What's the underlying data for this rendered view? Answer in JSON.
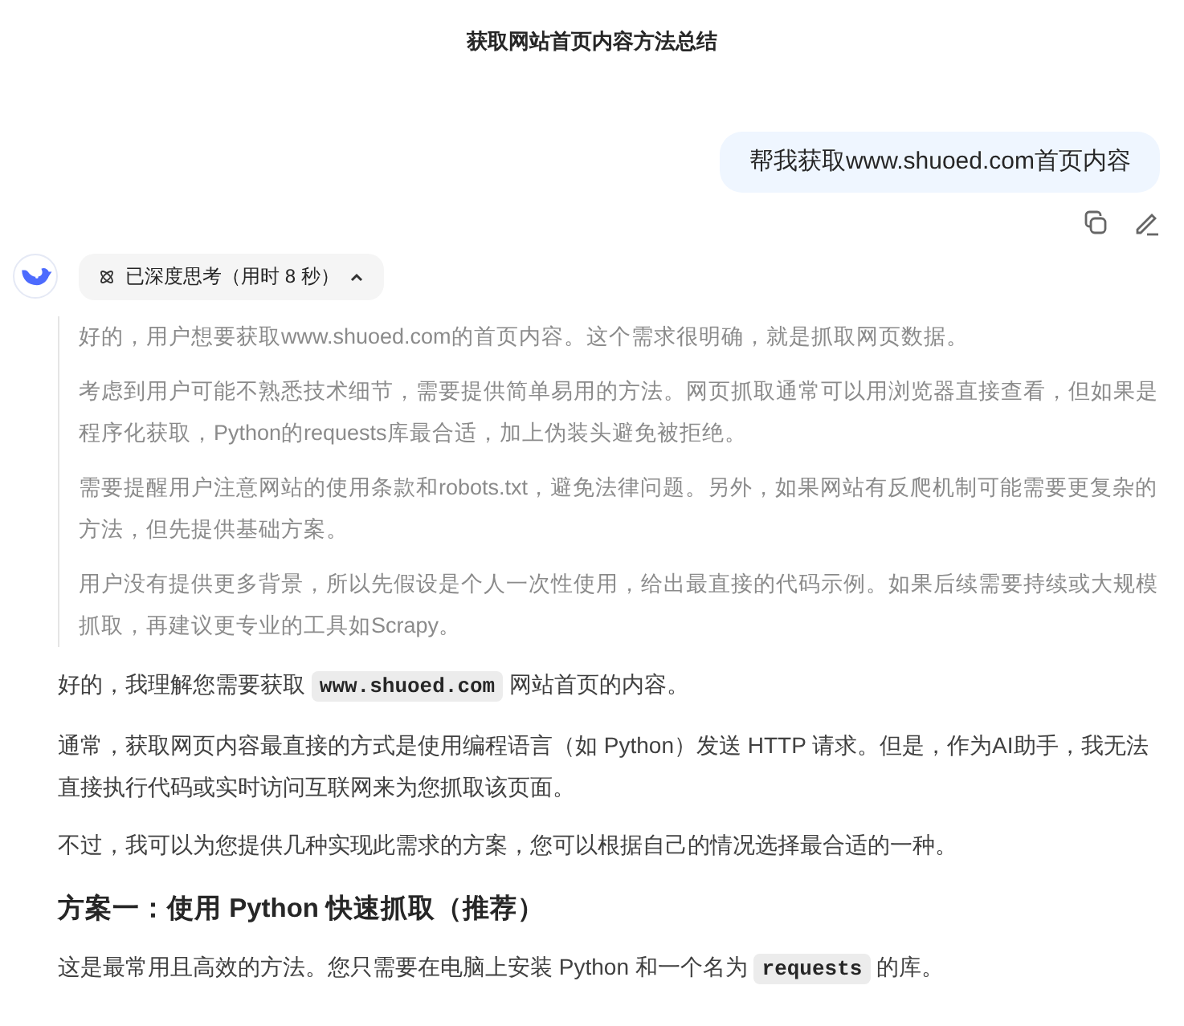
{
  "header": {
    "title": "获取网站首页内容方法总结"
  },
  "user_message": {
    "text": "帮我获取www.shuoed.com首页内容"
  },
  "message_actions": [
    {
      "kind": "copy"
    },
    {
      "kind": "edit"
    }
  ],
  "thinking": {
    "label": "已深度思考（用时 8 秒）",
    "expanded": true,
    "paragraphs": [
      "好的，用户想要获取www.shuoed.com的首页内容。这个需求很明确，就是抓取网页数据。",
      "考虑到用户可能不熟悉技术细节，需要提供简单易用的方法。网页抓取通常可以用浏览器直接查看，但如果是程序化获取，Python的requests库最合适，加上伪装头避免被拒绝。",
      "需要提醒用户注意网站的使用条款和robots.txt，避免法律问题。另外，如果网站有反爬机制可能需要更复杂的方法，但先提供基础方案。",
      "用户没有提供更多背景，所以先假设是个人一次性使用，给出最直接的代码示例。如果后续需要持续或大规模抓取，再建议更专业的工具如Scrapy。"
    ]
  },
  "answer": [
    {
      "kind": "paragraph",
      "parts": [
        {
          "kind": "text",
          "text": "好的，我理解您需要获取 "
        },
        {
          "kind": "code",
          "text": "www.shuoed.com"
        },
        {
          "kind": "text",
          "text": " 网站首页的内容。"
        }
      ]
    },
    {
      "kind": "paragraph",
      "parts": [
        {
          "kind": "text",
          "text": "通常，获取网页内容最直接的方式是使用编程语言（如 Python）发送 HTTP 请求。但是，作为AI助手，我无法直接执行代码或实时访问互联网来为您抓取该页面。"
        }
      ]
    },
    {
      "kind": "paragraph",
      "parts": [
        {
          "kind": "text",
          "text": "不过，我可以为您提供几种实现此需求的方案，您可以根据自己的情况选择最合适的一种。"
        }
      ]
    },
    {
      "kind": "heading",
      "parts": [
        {
          "kind": "text",
          "text": "方案一：使用 Python 快速抓取（推荐）"
        }
      ]
    },
    {
      "kind": "paragraph",
      "parts": [
        {
          "kind": "text",
          "text": "这是最常用且高效的方法。您只需要在电脑上安装 Python 和一个名为 "
        },
        {
          "kind": "code",
          "text": "requests"
        },
        {
          "kind": "text",
          "text": " 的库。"
        }
      ]
    }
  ]
}
